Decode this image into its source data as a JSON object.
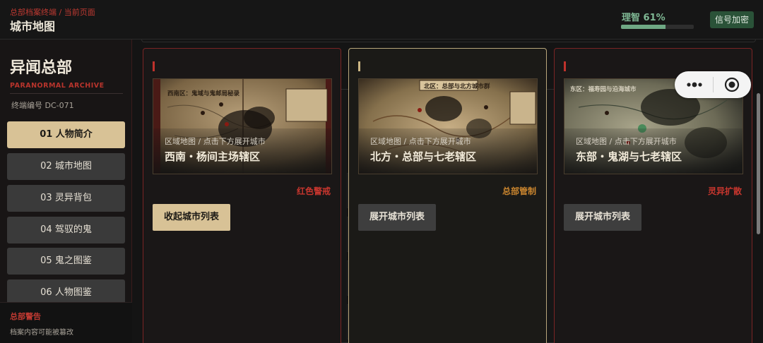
{
  "header": {
    "breadcrumb": "总部档案终端 / 当前页面",
    "title": "城市地图",
    "sanity_label": "理智 61%",
    "sanity_value": 0.61,
    "encrypt_button": "信号加密"
  },
  "sidebar": {
    "title": "异闻总部",
    "subtitle": "PARANORMAL ARCHIVE",
    "terminal_id": "终端编号 DC-071",
    "items": [
      {
        "label": "01 人物简介",
        "active": true
      },
      {
        "label": "02 城市地图",
        "active": false
      },
      {
        "label": "03 灵异背包",
        "active": false
      },
      {
        "label": "04 驾驭的鬼",
        "active": false
      },
      {
        "label": "05 鬼之图鉴",
        "active": false
      },
      {
        "label": "06 人物图鉴",
        "active": false
      }
    ],
    "warning_title": "总部警告",
    "warning_text": "档案内容可能被篡改"
  },
  "cards": [
    {
      "map_title": "西南区：鬼域与鬼邮局秘录",
      "caption_small": "区域地图 / 点击下方展开城市",
      "caption_big": "西南・杨间主场辖区",
      "badge": "红色警戒",
      "badge_color": "#c8362e",
      "button": "收起城市列表"
    },
    {
      "map_title": "北区：总部与北方城市群",
      "caption_small": "区域地图 / 点击下方展开城市",
      "caption_big": "北方・总部与七老辖区",
      "badge": "总部管制",
      "badge_color": "#c8842e",
      "button": "展开城市列表"
    },
    {
      "map_title": "东区：福寿园与沿海城市",
      "caption_small": "区域地图 / 点击下方展开城市",
      "caption_big": "东部・鬼湖与七老辖区",
      "badge": "灵异扩散",
      "badge_color": "#c8362e",
      "button": "展开城市列表"
    }
  ],
  "colors": {
    "accent_red": "#c03a32",
    "accent_gold": "#d8c296",
    "sanity_green": "#6fa884"
  }
}
